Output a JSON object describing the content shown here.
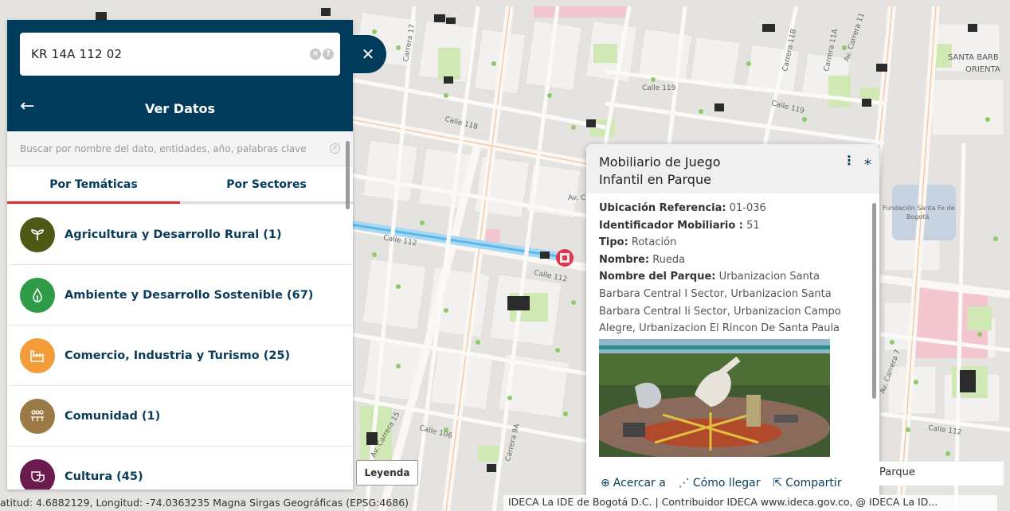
{
  "search": {
    "value": "KR 14A 112 02"
  },
  "panel": {
    "title": "Ver Datos",
    "filter_placeholder": "Buscar por nombre del dato, entidades, año, palabras clave",
    "tabs": [
      {
        "label": "Por Temáticas",
        "active": true
      },
      {
        "label": "Por Sectores",
        "active": false
      }
    ],
    "themes": [
      {
        "label": "Agricultura y Desarrollo Rural (1)",
        "icon": "sprout-icon",
        "color": "#4c5a16"
      },
      {
        "label": "Ambiente y Desarrollo Sostenible (67)",
        "icon": "leaf-drop-icon",
        "color": "#2e9b47"
      },
      {
        "label": "Comercio, Industria y Turismo (25)",
        "icon": "factory-icon",
        "color": "#f39c3a"
      },
      {
        "label": "Comunidad (1)",
        "icon": "people-icon",
        "color": "#9b7a45"
      },
      {
        "label": "Cultura (45)",
        "icon": "theater-masks-icon",
        "color": "#6a1b4d"
      }
    ]
  },
  "legend": {
    "label": "Leyenda"
  },
  "popup": {
    "title_line1": "Mobiliario de Juego",
    "title_line2": "Infantil en Parque",
    "fields": [
      {
        "key": "Ubicación Referencia:",
        "value": "01-036"
      },
      {
        "key": "Identificador Mobiliario :",
        "value": "51"
      },
      {
        "key": "Tipo:",
        "value": "Rotación"
      },
      {
        "key": "Nombre:",
        "value": "Rueda"
      },
      {
        "key": "Nombre del Parque:",
        "value": "Urbanizacion Santa Barbara Central I Sector, Urbanizacion Santa Barbara Central Ii Sector, Urbanizacion Campo Alegre, Urbanizacion El Rincon De Santa Paula"
      }
    ],
    "actions": [
      {
        "label": "Acercar a",
        "icon": "zoom-in-icon"
      },
      {
        "label": "Cómo llegar",
        "icon": "route-icon"
      },
      {
        "label": "Compartir",
        "icon": "share-icon"
      }
    ]
  },
  "parque_tag": "Parque",
  "status": {
    "coords": "atitud: 4.6882129, Longitud: -74.0363235 Magna Sirgas Geográficas (EPSG:4686)",
    "credits": "IDECA La IDE de Bogotá D.C. | Contribuidor IDECA www.ideca.gov.co, @ IDECA La ID..."
  },
  "map_labels": {
    "carrera17": "Carrera 17",
    "carrera11b": "Carrera 11B",
    "carrera11a": "Carrera 11A",
    "av_carrera11": "Av. Carrera 11",
    "santa_barbara": "SANTA BARB",
    "oriental": "ORIENTA",
    "calle119": "Calle 119",
    "calle119b": "Calle 119",
    "calle118": "Calle 118",
    "calle112a": "Calle 112",
    "calle112b": "Calle 112",
    "calle112c": "Calle 112",
    "av_c": "Av. C",
    "fundacion": "Fundación Santa Fe de",
    "bogota": "Bogotá",
    "av_carrera15": "Av. Carrera 15",
    "calle106": "Calle 106",
    "carrera9a": "Carrera 9A",
    "av_carrera7": "Av. Carrera 7"
  }
}
